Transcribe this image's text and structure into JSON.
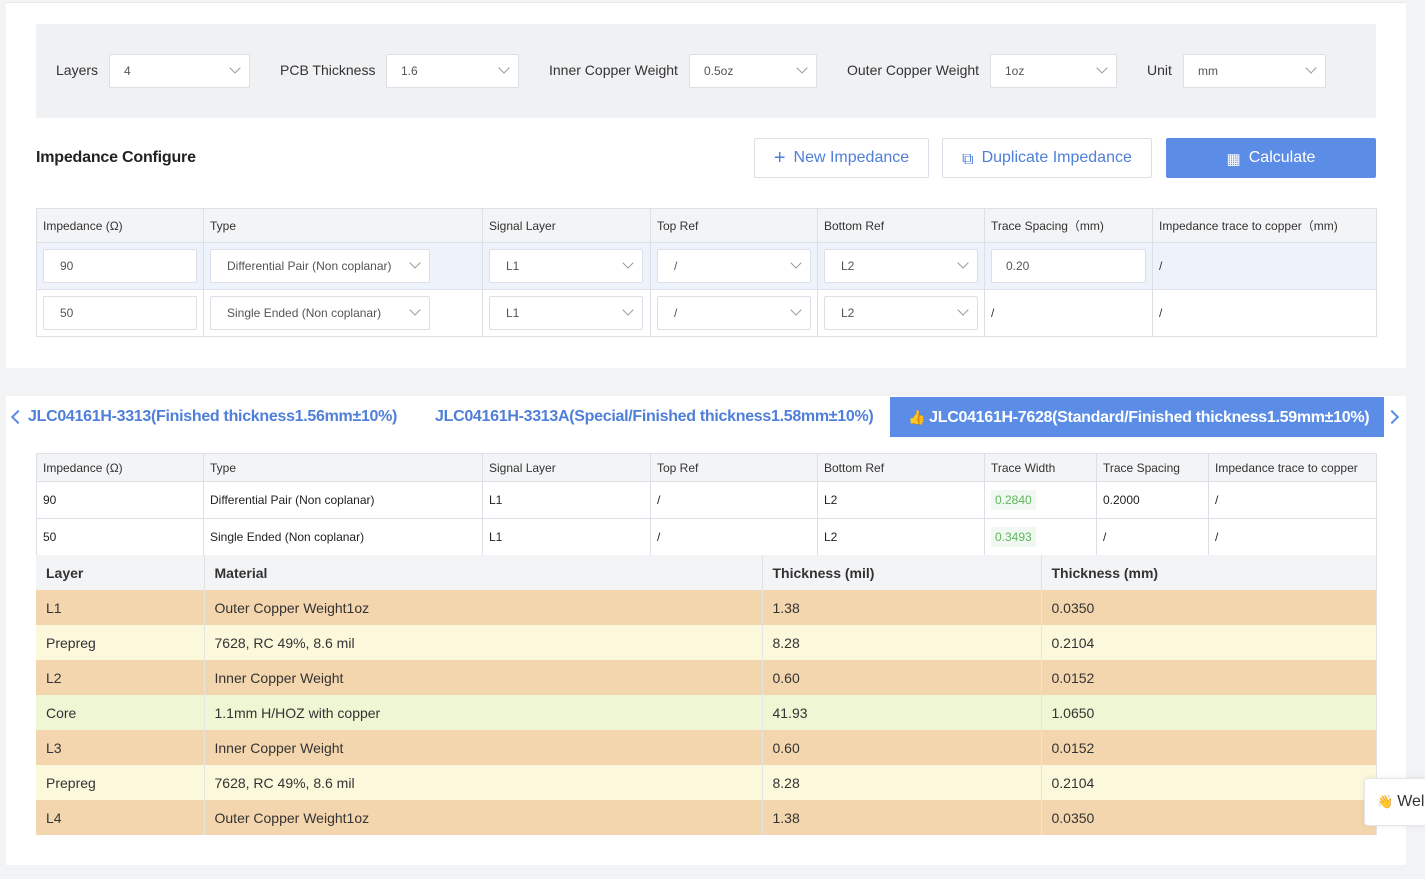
{
  "params": {
    "layers": {
      "label": "Layers",
      "value": "4"
    },
    "thickness": {
      "label": "PCB Thickness",
      "value": "1.6"
    },
    "inner_copper": {
      "label": "Inner Copper Weight",
      "value": "0.5oz"
    },
    "outer_copper": {
      "label": "Outer Copper Weight",
      "value": "1oz"
    },
    "unit": {
      "label": "Unit",
      "value": "mm"
    }
  },
  "configure": {
    "title": "Impedance Configure",
    "new_label": "New Impedance",
    "duplicate_label": "Duplicate Impedance",
    "calculate_label": "Calculate",
    "columns": [
      "Impedance (Ω)",
      "Type",
      "Signal Layer",
      "Top Ref",
      "Bottom Ref",
      "Trace Spacing（mm)",
      "Impedance trace to copper（mm)"
    ],
    "rows": [
      {
        "impedance": "90",
        "type": "Differential Pair (Non coplanar)",
        "signal": "L1",
        "top": "/",
        "bottom": "L2",
        "spacing": "0.20",
        "copper": "/"
      },
      {
        "impedance": "50",
        "type": "Single Ended (Non coplanar)",
        "signal": "L1",
        "top": "/",
        "bottom": "L2",
        "spacing": "/",
        "copper": "/"
      }
    ]
  },
  "tabs": [
    "JLC04161H-3313(Finished thickness1.56mm±10%)",
    "JLC04161H-3313A(Special/Finished thickness1.58mm±10%)",
    "JLC04161H-7628(Standard/Finished thickness1.59mm±10%)"
  ],
  "result": {
    "columns": [
      "Impedance (Ω)",
      "Type",
      "Signal Layer",
      "Top Ref",
      "Bottom Ref",
      "Trace Width",
      "Trace Spacing",
      "Impedance trace to copper"
    ],
    "rows": [
      [
        "90",
        "Differential Pair (Non coplanar)",
        "L1",
        "/",
        "L2",
        "0.2840",
        "0.2000",
        "/"
      ],
      [
        "50",
        "Single Ended (Non coplanar)",
        "L1",
        "/",
        "L2",
        "0.3493",
        "/",
        "/"
      ]
    ]
  },
  "stackup": {
    "columns": [
      "Layer",
      "Material",
      "Thickness (mil)",
      "Thickness (mm)"
    ],
    "rows": [
      [
        "L1",
        "Outer Copper Weight1oz",
        "1.38",
        "0.0350"
      ],
      [
        "Prepreg",
        "7628, RC 49%, 8.6 mil",
        "8.28",
        "0.2104"
      ],
      [
        "L2",
        "Inner Copper Weight",
        "0.60",
        "0.0152"
      ],
      [
        "Core",
        "1.1mm H/HOZ with copper",
        "41.93",
        "1.0650"
      ],
      [
        "L3",
        "Inner Copper Weight",
        "0.60",
        "0.0152"
      ],
      [
        "Prepreg",
        "7628, RC 49%, 8.6 mil",
        "8.28",
        "0.2104"
      ],
      [
        "L4",
        "Outer Copper Weight1oz",
        "1.38",
        "0.0350"
      ]
    ]
  },
  "welcome": {
    "text": "Wel",
    "icon": "waving-hand-icon"
  },
  "colors": {
    "accent": "#5b8de6",
    "copper_row": "#f4d6ae",
    "prepreg_row": "#fbf8dc",
    "core_row": "#eff6d3",
    "trace_width": "#5cb85c"
  }
}
